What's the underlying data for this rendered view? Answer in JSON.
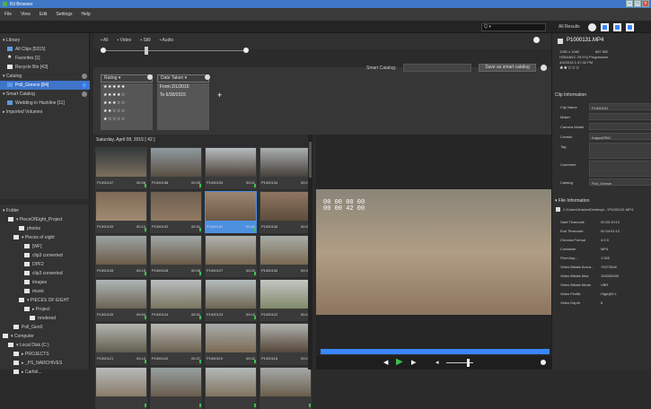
{
  "titlebar": {
    "title": "Kit Browser"
  },
  "menubar": [
    "File",
    "View",
    "Edit",
    "Settings",
    "Help"
  ],
  "toolbar": {
    "search_placeholder": "Q ▾",
    "all_results": "All Results"
  },
  "library": {
    "header": "▾ Library",
    "items": [
      {
        "label": "All Clips [5315]"
      },
      {
        "label": "Favorites [1]"
      },
      {
        "label": "Recycle Bin [43]"
      },
      {
        "label": "▾ Catalog"
      },
      {
        "label": "Poll_Greece [84]",
        "badge": "i"
      },
      {
        "label": "▾ Smart Catalog"
      },
      {
        "label": "Wedding in Hackline [11]"
      },
      {
        "label": "▸ Imported Volumes"
      }
    ]
  },
  "folder": {
    "header": "▾ Folder",
    "items": [
      {
        "label": "▾ PieceOfEight_Project",
        "indent": 6
      },
      {
        "label": "photos",
        "indent": 18
      },
      {
        "label": "▾ Pieces of eight",
        "indent": 12
      },
      {
        "label": "[WF]",
        "indent": 24
      },
      {
        "label": "clip3 converted",
        "indent": 24
      },
      {
        "label": "DPF2",
        "indent": 24
      },
      {
        "label": "clip3 converted",
        "indent": 24
      },
      {
        "label": "images",
        "indent": 24
      },
      {
        "label": "music",
        "indent": 24
      },
      {
        "label": "▾ PIECES OF EIGHT",
        "indent": 18
      },
      {
        "label": "▸ Project",
        "indent": 24
      },
      {
        "label": "rendered",
        "indent": 30
      },
      {
        "label": "Poll_Geo0",
        "indent": 12
      },
      {
        "label": "▾ Computer",
        "indent": 0
      },
      {
        "label": "▾ Local Disk (C:)",
        "indent": 6
      },
      {
        "label": "▸ PROJECTS",
        "indent": 12
      },
      {
        "label": "▸ _PS_NARCHIVES",
        "indent": 12
      },
      {
        "label": "▸ Carfoil...",
        "indent": 12
      }
    ]
  },
  "filters": {
    "type_filters": [
      "All",
      "Video",
      "Still",
      "Audio"
    ],
    "rating": {
      "label": "Rating",
      "rows": [
        "★★★★★",
        "★★★★☆",
        "★★★☆☆",
        "★★☆☆☆",
        "★☆☆☆☆"
      ]
    },
    "date": {
      "label": "Date Taken",
      "rows": [
        "From 2/1/2015",
        "To 6/30/2015"
      ]
    },
    "add": "+",
    "smart_catalog_label": "Smart Catalog:",
    "save_button": "Save as smart catalog"
  },
  "grid": {
    "header": "Saturday, April 08, 2015 [ 42 ]",
    "thumbs": [
      {
        "name": "P1000137",
        "dur": "00:08",
        "c1": "#333a3b",
        "c2": "#7c6e5e"
      },
      {
        "name": "P1000138",
        "dur": "00:25",
        "c1": "#8f9aa0",
        "c2": "#5a4f42"
      },
      {
        "name": "P1000133",
        "dur": "00:21",
        "c1": "#b7bcbe",
        "c2": "#4a4139"
      },
      {
        "name": "P1000134",
        "dur": "00:25",
        "c1": "#a9aeb0",
        "c2": "#46403a"
      },
      {
        "name": "P1000133",
        "dur": "00:12",
        "c1": "#7e6a58",
        "c2": "#a08a70"
      },
      {
        "name": "P1000132",
        "dur": "00:31",
        "c1": "#6e5f50",
        "c2": "#917a63"
      },
      {
        "name": "P1000131",
        "dur": "00:40",
        "c1": "#9a8570",
        "c2": "#6c5846"
      },
      {
        "name": "P1000130",
        "dur": "00:32",
        "c1": "#8e7762",
        "c2": "#5e4c3c"
      },
      {
        "name": "P1000128",
        "dur": "00:15",
        "c1": "#9aa3a3",
        "c2": "#6d5b48"
      },
      {
        "name": "P1000128",
        "dur": "00:28",
        "c1": "#a0a6a4",
        "c2": "#6a5a48"
      },
      {
        "name": "P1000127",
        "dur": "00:20",
        "c1": "#aeb2ae",
        "c2": "#77674f"
      },
      {
        "name": "P1000130",
        "dur": "00:38",
        "c1": "#a8aca7",
        "c2": "#7a6952"
      },
      {
        "name": "P1000125",
        "dur": "00:54",
        "c1": "#aeb6b8",
        "c2": "#6b6352"
      },
      {
        "name": "P1000124",
        "dur": "00:31",
        "c1": "#b8bec0",
        "c2": "#7a7560"
      },
      {
        "name": "P1000123",
        "dur": "00:15",
        "c1": "#b4bbbd",
        "c2": "#6d6653"
      },
      {
        "name": "P1000122",
        "dur": "00:24",
        "c1": "#c4c6c3",
        "c2": "#808a6a"
      },
      {
        "name": "P1000121",
        "dur": "00:12",
        "c1": "#b5b6b2",
        "c2": "#5f5d4d"
      },
      {
        "name": "P1000120",
        "dur": "00:37",
        "c1": "#b7b6b1",
        "c2": "#6a6050"
      },
      {
        "name": "P1000119",
        "dur": "00:42",
        "c1": "#a8acab",
        "c2": "#7c6b55"
      },
      {
        "name": "P1000118",
        "dur": "00:23",
        "c1": "#b0b2ae",
        "c2": "#54463a"
      },
      {
        "name": "",
        "dur": "",
        "c1": "#b7bbbb",
        "c2": "#8a7c69"
      },
      {
        "name": "",
        "dur": "",
        "c1": "#98a0a2",
        "c2": "#6a5d4d"
      },
      {
        "name": "",
        "dur": "",
        "c1": "#b3b8b8",
        "c2": "#817460"
      },
      {
        "name": "",
        "dur": "",
        "c1": "#a4a9a7",
        "c2": "#6b5e4c"
      }
    ]
  },
  "preview": {
    "timecode_line1": "00 00 00 00",
    "timecode_line2": "00 00 42 00"
  },
  "props": {
    "filename": "P1000131.MP4",
    "resolution": "1280 x 1080",
    "size": "687 MB",
    "codec": "H264/AVC  29.97p  Progressive",
    "date": "4/4/2015 1:47:32 PM",
    "rating": "★★☆☆☆",
    "clip_info_header": "Clip Information",
    "clip_fields": [
      {
        "label": "Clip Name",
        "value": "P1000131"
      },
      {
        "label": "Maker",
        "value": ""
      },
      {
        "label": "Camera Model",
        "value": ""
      },
      {
        "label": "Creator",
        "value": "KappaOPAl"
      },
      {
        "label": "Tag",
        "value": ""
      },
      {
        "label": "Comment",
        "value": ""
      },
      {
        "label": "Catalog",
        "value": "Poll_Greece"
      }
    ],
    "file_info_header": "▾ File Information",
    "path": "C:\\Users\\Kasten\\Desktop\\...\\P1000131.MP4",
    "file_fields": [
      {
        "label": "Start Timecode",
        "value": "00:33:19:12"
      },
      {
        "label": "End Timecode",
        "value": "00:34:01:12"
      },
      {
        "label": "Chroma Format",
        "value": "4:2:0"
      },
      {
        "label": "Container",
        "value": "MP4"
      },
      {
        "label": "Pixel Asp...",
        "value": "1.000"
      },
      {
        "label": "Video Bitrate Avera...",
        "value": "70072846"
      },
      {
        "label": "Video Bitrate Max",
        "value": "100000000"
      },
      {
        "label": "Video Bitrate Mode",
        "value": "VBR"
      },
      {
        "label": "Video Profile",
        "value": "High@5.1"
      },
      {
        "label": "Video Depth",
        "value": "8"
      }
    ]
  },
  "colors": {
    "accent": "#3a86ff",
    "titlebar": "#3e78c6",
    "selection": "#3f74c9"
  }
}
